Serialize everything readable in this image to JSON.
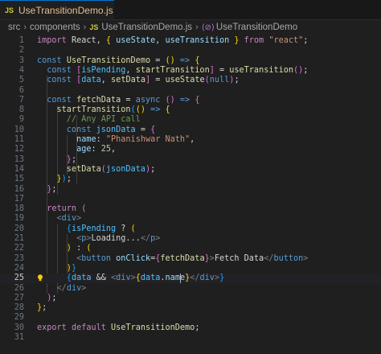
{
  "tab": {
    "js_badge": "JS",
    "title": "UseTransitionDemo.js",
    "modified": "U"
  },
  "breadcrumb": {
    "segments": [
      "src",
      "components"
    ],
    "file_badge": "JS",
    "file": "UseTransitionDemo.js",
    "symbol_icon": "⟨⊘⟩",
    "symbol": "UseTransitionDemo"
  },
  "icons": {
    "lightbulb": "lightbulb-icon"
  },
  "editor": {
    "current_line": 25,
    "lines": [
      {
        "n": "1",
        "t": [
          [
            "import",
            "t-kw"
          ],
          [
            " React, ",
            "t-pl"
          ],
          [
            "{",
            "t-y"
          ],
          [
            " useState, useTransition ",
            "t-var"
          ],
          [
            "}",
            "t-y"
          ],
          [
            " from ",
            "t-kw"
          ],
          [
            "\"react\"",
            "t-str"
          ],
          [
            ";",
            "t-pl"
          ]
        ]
      },
      {
        "n": "2",
        "t": []
      },
      {
        "n": "3",
        "t": [
          [
            "const",
            "t-decl"
          ],
          [
            " ",
            "t-pl"
          ],
          [
            "UseTransitionDemo",
            "t-fn"
          ],
          [
            " = ",
            "t-pl"
          ],
          [
            "()",
            "t-y"
          ],
          [
            " ",
            "t-pl"
          ],
          [
            "=>",
            "t-decl"
          ],
          [
            " ",
            "t-pl"
          ],
          [
            "{",
            "t-y"
          ]
        ]
      },
      {
        "n": "4",
        "t": [
          [
            "  const",
            "t-decl"
          ],
          [
            " ",
            "t-pl"
          ],
          [
            "[",
            "t-p"
          ],
          [
            "isPending",
            "t-const"
          ],
          [
            ", ",
            "t-pl"
          ],
          [
            "startTransition",
            "t-fn"
          ],
          [
            "]",
            "t-p"
          ],
          [
            " = ",
            "t-pl"
          ],
          [
            "useTransition",
            "t-fn"
          ],
          [
            "()",
            "t-p"
          ],
          [
            ";",
            "t-pl"
          ]
        ]
      },
      {
        "n": "5",
        "t": [
          [
            "  const",
            "t-decl"
          ],
          [
            " ",
            "t-pl"
          ],
          [
            "[",
            "t-p"
          ],
          [
            "data",
            "t-const"
          ],
          [
            ", ",
            "t-pl"
          ],
          [
            "setData",
            "t-fn"
          ],
          [
            "]",
            "t-p"
          ],
          [
            " = ",
            "t-pl"
          ],
          [
            "useState",
            "t-fn"
          ],
          [
            "(",
            "t-p"
          ],
          [
            "null",
            "t-decl"
          ],
          [
            ")",
            "t-p"
          ],
          [
            ";",
            "t-pl"
          ]
        ]
      },
      {
        "n": "6",
        "t": []
      },
      {
        "n": "7",
        "t": [
          [
            "  const",
            "t-decl"
          ],
          [
            " ",
            "t-pl"
          ],
          [
            "fetchData",
            "t-fn"
          ],
          [
            " = ",
            "t-pl"
          ],
          [
            "async",
            "t-decl"
          ],
          [
            " ",
            "t-pl"
          ],
          [
            "()",
            "t-p"
          ],
          [
            " ",
            "t-pl"
          ],
          [
            "=>",
            "t-decl"
          ],
          [
            " ",
            "t-pl"
          ],
          [
            "{",
            "t-p"
          ]
        ]
      },
      {
        "n": "8",
        "t": [
          [
            "    startTransition",
            "t-fn"
          ],
          [
            "(",
            "t-b"
          ],
          [
            "()",
            "t-y"
          ],
          [
            " ",
            "t-pl"
          ],
          [
            "=>",
            "t-decl"
          ],
          [
            " ",
            "t-pl"
          ],
          [
            "{",
            "t-y"
          ]
        ]
      },
      {
        "n": "9",
        "t": [
          [
            "      // Any API call",
            "t-cmt"
          ]
        ]
      },
      {
        "n": "10",
        "t": [
          [
            "      const",
            "t-decl"
          ],
          [
            " ",
            "t-pl"
          ],
          [
            "jsonData",
            "t-const"
          ],
          [
            " = ",
            "t-pl"
          ],
          [
            "{",
            "t-p"
          ]
        ]
      },
      {
        "n": "11",
        "t": [
          [
            "        name",
            "t-nm"
          ],
          [
            ": ",
            "t-pl"
          ],
          [
            "\"Phanishwar Nath\"",
            "t-str"
          ],
          [
            ",",
            "t-pl"
          ]
        ]
      },
      {
        "n": "12",
        "t": [
          [
            "        age",
            "t-nm"
          ],
          [
            ": ",
            "t-pl"
          ],
          [
            "25",
            "t-num"
          ],
          [
            ",",
            "t-pl"
          ]
        ]
      },
      {
        "n": "13",
        "t": [
          [
            "      }",
            "t-p"
          ],
          [
            ";",
            "t-pl"
          ]
        ]
      },
      {
        "n": "14",
        "t": [
          [
            "      setData",
            "t-fn"
          ],
          [
            "(",
            "t-p"
          ],
          [
            "jsonData",
            "t-const"
          ],
          [
            ")",
            "t-p"
          ],
          [
            ";",
            "t-pl"
          ]
        ]
      },
      {
        "n": "15",
        "t": [
          [
            "    }",
            "t-y"
          ],
          [
            ")",
            "t-b"
          ],
          [
            ";",
            "t-pl"
          ]
        ]
      },
      {
        "n": "16",
        "t": [
          [
            "  }",
            "t-p"
          ],
          [
            ";",
            "t-pl"
          ]
        ]
      },
      {
        "n": "17",
        "t": []
      },
      {
        "n": "18",
        "t": [
          [
            "  return",
            "t-kw"
          ],
          [
            " ",
            "t-pl"
          ],
          [
            "(",
            "t-p"
          ]
        ]
      },
      {
        "n": "19",
        "t": [
          [
            "    <",
            "t-tagb"
          ],
          [
            "div",
            "t-tag"
          ],
          [
            ">",
            "t-tagb"
          ]
        ]
      },
      {
        "n": "20",
        "t": [
          [
            "      {",
            "t-b"
          ],
          [
            "isPending",
            "t-const"
          ],
          [
            " ? ",
            "t-pl"
          ],
          [
            "(",
            "t-y"
          ]
        ]
      },
      {
        "n": "21",
        "t": [
          [
            "        <",
            "t-tagb"
          ],
          [
            "p",
            "t-tag"
          ],
          [
            ">",
            "t-tagb"
          ],
          [
            "Loading...",
            "t-pl"
          ],
          [
            "</",
            "t-tagb"
          ],
          [
            "p",
            "t-tag"
          ],
          [
            ">",
            "t-tagb"
          ]
        ]
      },
      {
        "n": "22",
        "t": [
          [
            "      )",
            "t-y"
          ],
          [
            " : ",
            "t-pl"
          ],
          [
            "(",
            "t-y"
          ]
        ]
      },
      {
        "n": "23",
        "t": [
          [
            "        <",
            "t-tagb"
          ],
          [
            "button",
            "t-tag"
          ],
          [
            " ",
            "t-pl"
          ],
          [
            "onClick",
            "t-attr"
          ],
          [
            "=",
            "t-pl"
          ],
          [
            "{",
            "t-p"
          ],
          [
            "fetchData",
            "t-fn"
          ],
          [
            "}",
            "t-p"
          ],
          [
            ">",
            "t-tagb"
          ],
          [
            "Fetch Data",
            "t-pl"
          ],
          [
            "</",
            "t-tagb"
          ],
          [
            "button",
            "t-tag"
          ],
          [
            ">",
            "t-tagb"
          ]
        ]
      },
      {
        "n": "24",
        "t": [
          [
            "      )",
            "t-y"
          ],
          [
            "}",
            "t-b"
          ]
        ]
      },
      {
        "n": "25",
        "t": [
          [
            "      {",
            "t-b"
          ],
          [
            "data",
            "t-const"
          ],
          [
            " && ",
            "t-pl"
          ],
          [
            "<",
            "t-tagb"
          ],
          [
            "div",
            "t-tag"
          ],
          [
            ">",
            "t-tagb"
          ],
          [
            "{",
            "t-y"
          ],
          [
            "data",
            "t-const"
          ],
          [
            ".",
            "t-pl"
          ],
          [
            "name",
            "t-nm"
          ],
          [
            "}",
            "t-y"
          ],
          [
            "</",
            "t-tagb"
          ],
          [
            "div",
            "t-tag"
          ],
          [
            ">",
            "t-tagb"
          ],
          [
            "}",
            "t-b"
          ]
        ]
      },
      {
        "n": "26",
        "t": [
          [
            "    </",
            "t-tagb"
          ],
          [
            "div",
            "t-tag"
          ],
          [
            ">",
            "t-tagb"
          ]
        ]
      },
      {
        "n": "27",
        "t": [
          [
            "  )",
            "t-p"
          ],
          [
            ";",
            "t-pl"
          ]
        ]
      },
      {
        "n": "28",
        "t": [
          [
            "}",
            "t-y"
          ],
          [
            ";",
            "t-pl"
          ]
        ]
      },
      {
        "n": "29",
        "t": []
      },
      {
        "n": "30",
        "t": [
          [
            "export",
            "t-kw"
          ],
          [
            " ",
            "t-pl"
          ],
          [
            "default",
            "t-kw"
          ],
          [
            " ",
            "t-pl"
          ],
          [
            "UseTransitionDemo",
            "t-fn"
          ],
          [
            ";",
            "t-pl"
          ]
        ]
      },
      {
        "n": "31",
        "t": []
      }
    ]
  }
}
